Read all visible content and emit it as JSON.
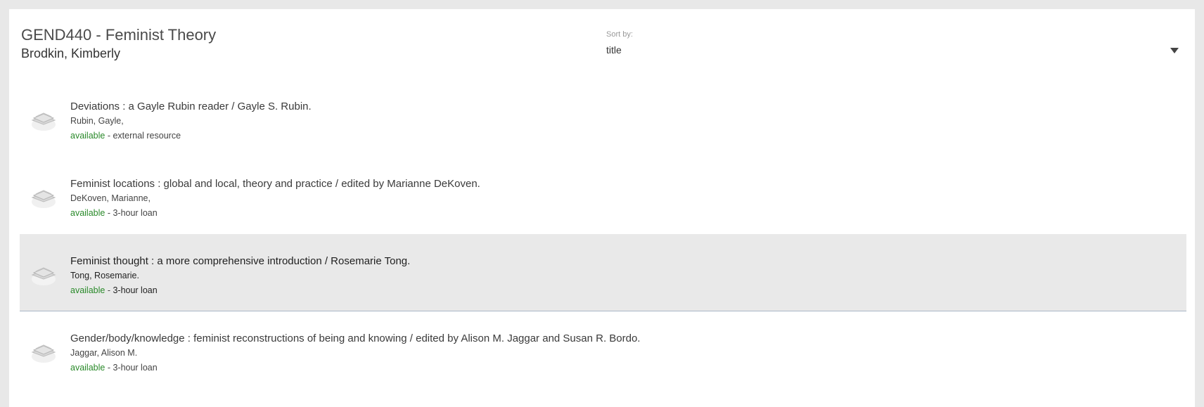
{
  "course": {
    "title": "GEND440 - Feminist Theory",
    "instructor": "Brodkin, Kimberly"
  },
  "sort": {
    "label": "Sort by:",
    "value": "title"
  },
  "items": [
    {
      "title": "Deviations : a Gayle Rubin reader / Gayle S. Rubin.",
      "author": "Rubin, Gayle,",
      "status": "available",
      "separator": " - ",
      "loan_type": "external resource",
      "icon": "book-icon"
    },
    {
      "title": "Feminist locations : global and local, theory and practice / edited by Marianne DeKoven.",
      "author": "DeKoven, Marianne,",
      "status": "available",
      "separator": " - ",
      "loan_type": "3-hour loan",
      "icon": "book-icon"
    },
    {
      "title": "Feminist thought : a more comprehensive introduction / Rosemarie Tong.",
      "author": "Tong, Rosemarie.",
      "status": "available",
      "separator": " - ",
      "loan_type": "3-hour loan",
      "icon": "book-icon",
      "selected": true
    },
    {
      "title": "Gender/body/knowledge : feminist reconstructions of being and knowing / edited by Alison M. Jaggar and Susan R. Bordo.",
      "author": "Jaggar, Alison M.",
      "status": "available",
      "separator": " - ",
      "loan_type": "3-hour loan",
      "icon": "book-icon"
    }
  ],
  "colors": {
    "available": "#2a8a2a",
    "selected_bg": "#e9e9e9",
    "page_bg": "#e8e8e8"
  }
}
